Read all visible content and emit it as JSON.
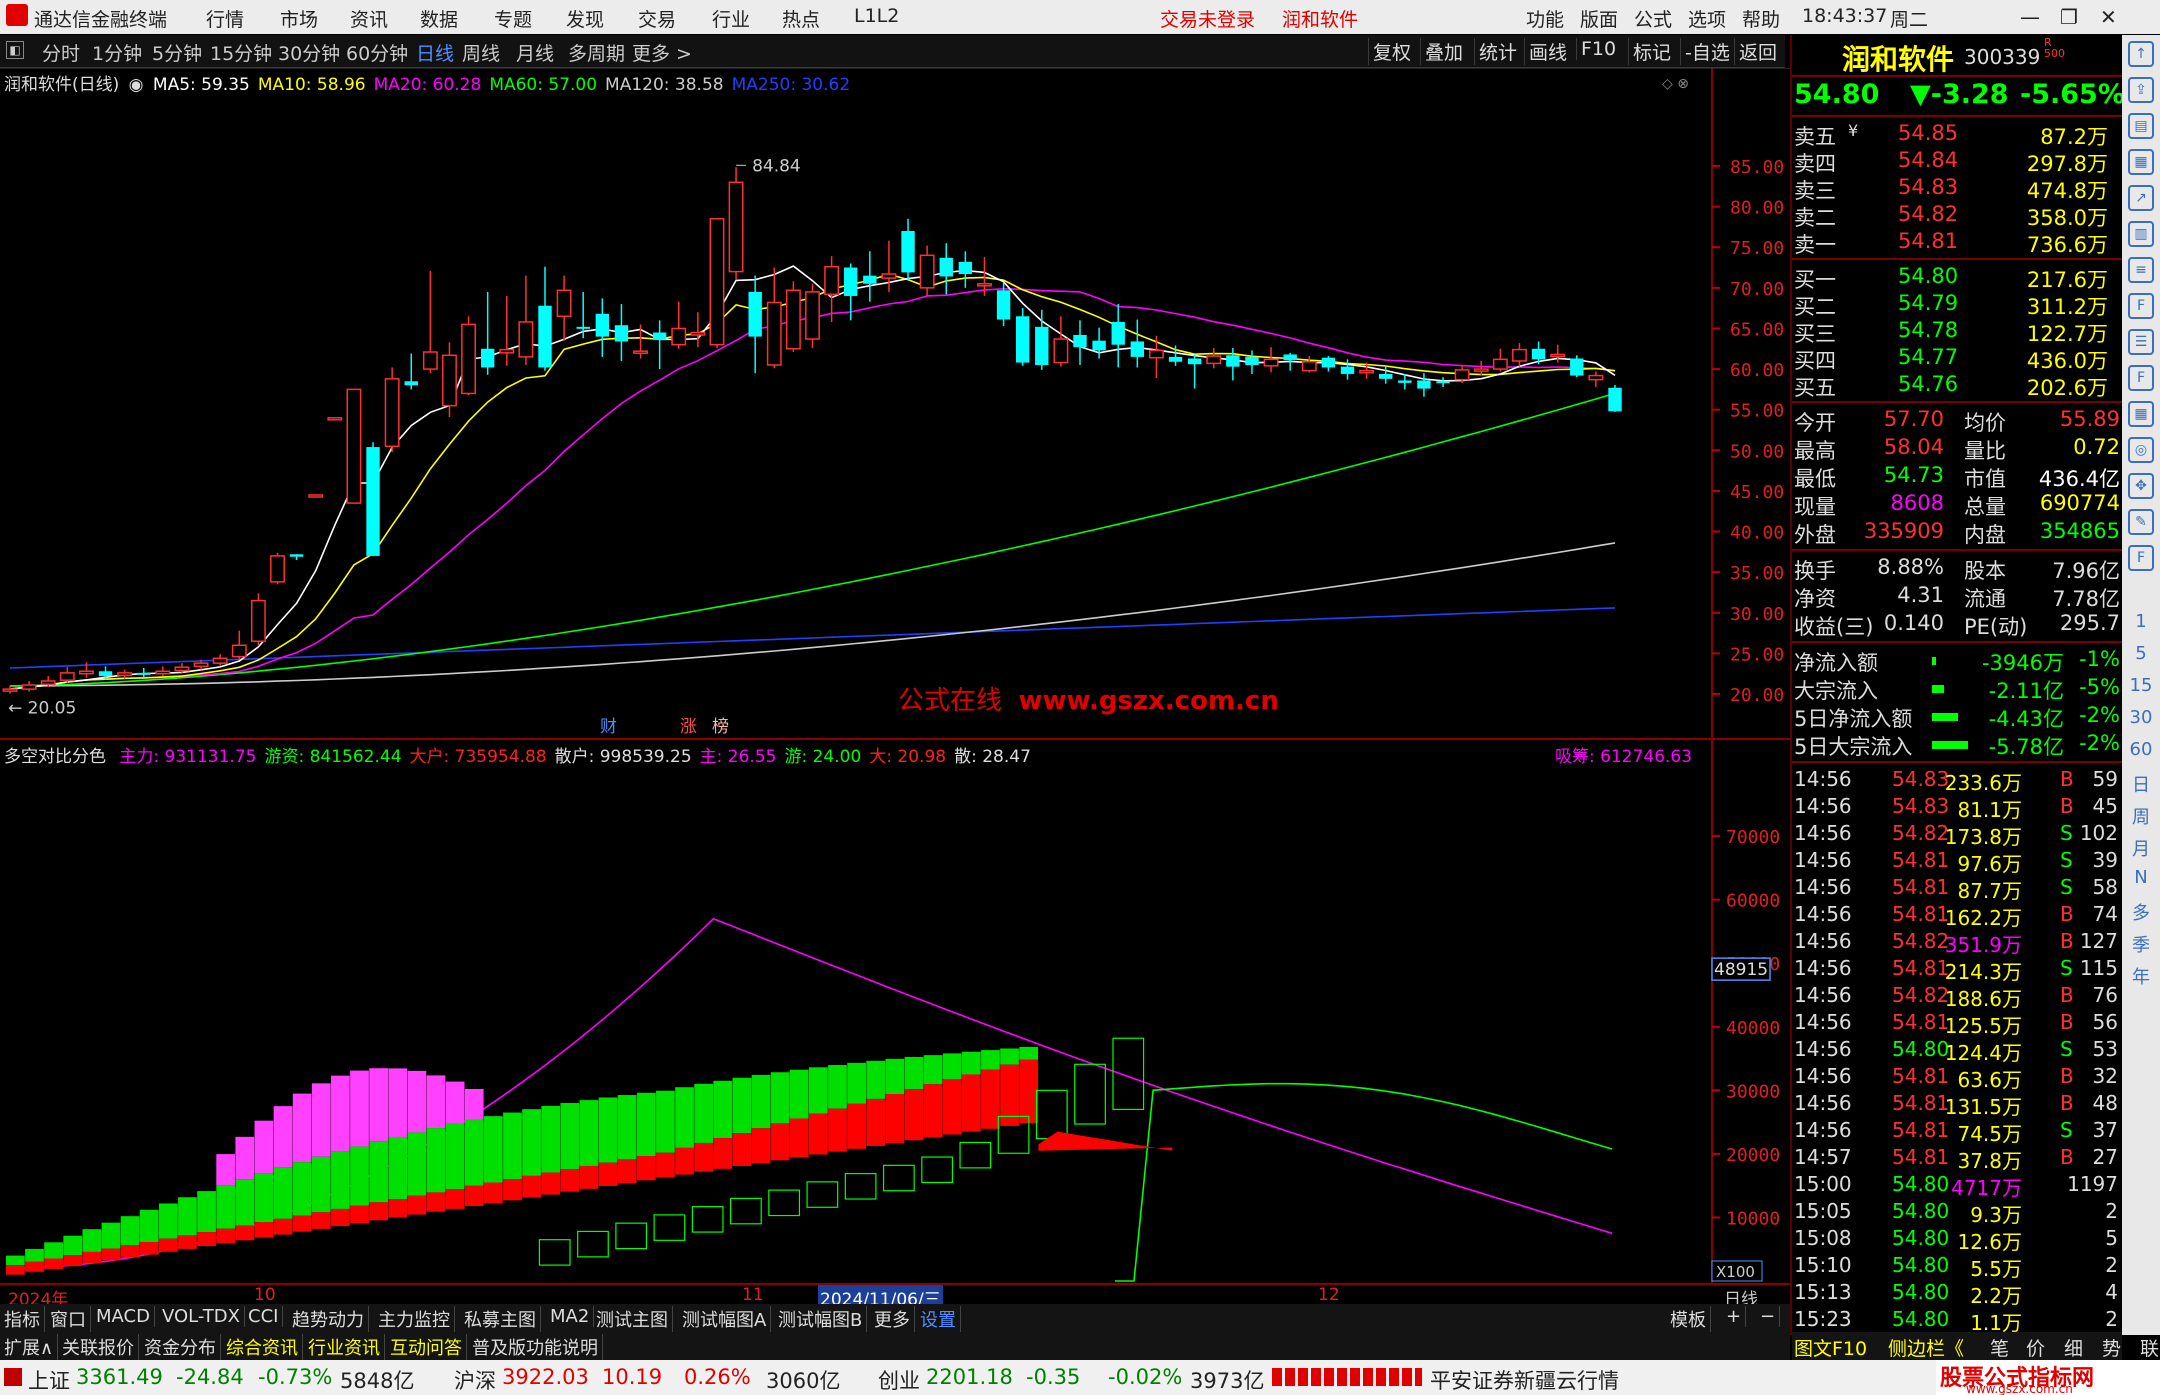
{
  "titlebar": {
    "app_title": "通达信金融终端",
    "menus": [
      "行情",
      "市场",
      "资讯",
      "数据",
      "专题",
      "发现",
      "交易",
      "行业",
      "热点",
      "L1L2"
    ],
    "trade_status": "交易未登录",
    "stock_name": "润和软件",
    "right_menus": [
      "功能",
      "版面",
      "公式",
      "选项",
      "帮助"
    ],
    "time": "18:43:37",
    "weekday": "周二"
  },
  "toolbar": {
    "periods": [
      "分时",
      "1分钟",
      "5分钟",
      "15分钟",
      "30分钟",
      "60分钟",
      "日线",
      "周线",
      "月线",
      "多周期",
      "更多 >"
    ],
    "active_period": "日线",
    "right_buttons": [
      "复权",
      "叠加",
      "统计",
      "画线",
      "F10",
      "标记",
      "-自选",
      "返回"
    ]
  },
  "main_chart": {
    "legend_prefix": "润和软件(日线)",
    "ma_labels": [
      {
        "text": "MA5: 59.35",
        "color": "#ffffff"
      },
      {
        "text": "MA10: 58.96",
        "color": "#ffff00"
      },
      {
        "text": "MA20: 60.28",
        "color": "#ff00ff"
      },
      {
        "text": "MA60: 57.00",
        "color": "#00ff00"
      },
      {
        "text": "MA120: 38.58",
        "color": "#cccccc"
      },
      {
        "text": "MA250: 30.62",
        "color": "#2040ff"
      }
    ],
    "high_label": "84.84",
    "low_label": "20.05",
    "price_ticks": [
      "85.00",
      "80.00",
      "75.00",
      "70.00",
      "65.00",
      "60.00",
      "55.00",
      "50.00",
      "45.00",
      "40.00",
      "35.00",
      "30.00",
      "25.00",
      "20.00"
    ],
    "watermark_cn": "公式在线",
    "watermark_url": "www.gszx.com.cn",
    "event_tags": [
      "财",
      "涨",
      "榜"
    ]
  },
  "sub_chart": {
    "title": "多空对比分色",
    "values": [
      {
        "text": "主力: 931131.75",
        "color": "#ff00ff"
      },
      {
        "text": "游资: 841562.44",
        "color": "#00ff00"
      },
      {
        "text": "大户: 735954.88",
        "color": "#ff2020"
      },
      {
        "text": "散户: 998539.25",
        "color": "#dddddd"
      },
      {
        "text": "主: 26.55",
        "color": "#ff00ff"
      },
      {
        "text": "游: 24.00",
        "color": "#00ff00"
      },
      {
        "text": "大: 20.98",
        "color": "#ff2020"
      },
      {
        "text": "散: 28.47",
        "color": "#dddddd"
      }
    ],
    "absorb_label": "吸筹: 612746.63",
    "y_ticks": [
      "70000",
      "60000",
      "50000",
      "40000",
      "30000",
      "20000",
      "10000"
    ],
    "current_value": "48915",
    "scale_label": "X100"
  },
  "date_axis": {
    "labels": [
      "2024年",
      "10",
      "11",
      "2024/11/06/三",
      "12"
    ],
    "period_label": "日线"
  },
  "bottom_tabs": [
    "指标",
    "窗口",
    "MACD",
    "VOL-TDX",
    "CCI",
    "趋势动力",
    "主力监控",
    "私募主图",
    "MA2",
    "测试主图",
    "测试幅图A",
    "测试幅图B",
    "更多",
    "设置"
  ],
  "bottom_right": [
    "模板",
    "+",
    "−"
  ],
  "bottom_tabs2": [
    "扩展∧",
    "关联报价",
    "资金分布",
    "综合资讯",
    "行业资讯",
    "互动问答",
    "普及版功能说明"
  ],
  "quote": {
    "name": "润和软件",
    "code": "300339",
    "price": "54.80",
    "change": "▼-3.28",
    "pct": "-5.65%",
    "asks": [
      {
        "label": "卖五",
        "p": "54.85",
        "v": "87.2万"
      },
      {
        "label": "卖四",
        "p": "54.84",
        "v": "297.8万"
      },
      {
        "label": "卖三",
        "p": "54.83",
        "v": "474.8万"
      },
      {
        "label": "卖二",
        "p": "54.82",
        "v": "358.0万"
      },
      {
        "label": "卖一",
        "p": "54.81",
        "v": "736.6万"
      }
    ],
    "bids": [
      {
        "label": "买一",
        "p": "54.80",
        "v": "217.6万"
      },
      {
        "label": "买二",
        "p": "54.79",
        "v": "311.2万"
      },
      {
        "label": "买三",
        "p": "54.78",
        "v": "122.7万"
      },
      {
        "label": "买四",
        "p": "54.77",
        "v": "436.0万"
      },
      {
        "label": "买五",
        "p": "54.76",
        "v": "202.6万"
      }
    ],
    "stats1": [
      {
        "k1": "今开",
        "v1": "57.70",
        "k2": "均价",
        "v2": "55.89",
        "c1": "#ff3030",
        "c2": "#ff3030"
      },
      {
        "k1": "最高",
        "v1": "58.04",
        "k2": "量比",
        "v2": "0.72",
        "c1": "#ff3030",
        "c2": "#ffff00"
      },
      {
        "k1": "最低",
        "v1": "54.73",
        "k2": "市值",
        "v2": "436.4亿",
        "c1": "#00ff00",
        "c2": "#ffffff"
      },
      {
        "k1": "现量",
        "v1": "8608",
        "k2": "总量",
        "v2": "690774",
        "c1": "#ff00ff",
        "c2": "#ffff00"
      },
      {
        "k1": "外盘",
        "v1": "335909",
        "k2": "内盘",
        "v2": "354865",
        "c1": "#ff3030",
        "c2": "#00ff00"
      }
    ],
    "stats2": [
      {
        "k1": "换手",
        "v1": "8.88%",
        "k2": "股本",
        "v2": "7.96亿"
      },
      {
        "k1": "净资",
        "v1": "4.31",
        "k2": "流通",
        "v2": "7.78亿"
      },
      {
        "k1": "收益(三)",
        "v1": "0.140",
        "k2": "PE(动)",
        "v2": "295.7"
      }
    ],
    "flows": [
      {
        "k": "净流入额",
        "v": "-3946万",
        "p": "-1%",
        "bar": 4
      },
      {
        "k": "大宗流入",
        "v": "-2.11亿",
        "p": "-5%",
        "bar": 12
      },
      {
        "k": "5日净流入额",
        "v": "-4.43亿",
        "p": "-2%",
        "bar": 26
      },
      {
        "k": "5日大宗流入",
        "v": "-5.78亿",
        "p": "-2%",
        "bar": 36
      }
    ],
    "ticks": [
      {
        "t": "14:56",
        "p": "54.83",
        "v": "233.6万",
        "s": "B",
        "n": "59",
        "pc": "#ff3030",
        "vc": "#ffff00"
      },
      {
        "t": "14:56",
        "p": "54.83",
        "v": "81.1万",
        "s": "B",
        "n": "45",
        "pc": "#ff3030",
        "vc": "#ffff00"
      },
      {
        "t": "14:56",
        "p": "54.82",
        "v": "173.8万",
        "s": "S",
        "n": "102",
        "pc": "#ff3030",
        "vc": "#ffff00"
      },
      {
        "t": "14:56",
        "p": "54.81",
        "v": "97.6万",
        "s": "S",
        "n": "39",
        "pc": "#ff3030",
        "vc": "#ffff00"
      },
      {
        "t": "14:56",
        "p": "54.81",
        "v": "87.7万",
        "s": "S",
        "n": "58",
        "pc": "#ff3030",
        "vc": "#ffff00"
      },
      {
        "t": "14:56",
        "p": "54.81",
        "v": "162.2万",
        "s": "B",
        "n": "74",
        "pc": "#ff3030",
        "vc": "#ffff00"
      },
      {
        "t": "14:56",
        "p": "54.82",
        "v": "351.9万",
        "s": "B",
        "n": "127",
        "pc": "#ff3030",
        "vc": "#ff00ff"
      },
      {
        "t": "14:56",
        "p": "54.81",
        "v": "214.3万",
        "s": "S",
        "n": "115",
        "pc": "#ff3030",
        "vc": "#ffff00"
      },
      {
        "t": "14:56",
        "p": "54.82",
        "v": "188.6万",
        "s": "B",
        "n": "76",
        "pc": "#ff3030",
        "vc": "#ffff00"
      },
      {
        "t": "14:56",
        "p": "54.81",
        "v": "125.5万",
        "s": "B",
        "n": "56",
        "pc": "#ff3030",
        "vc": "#ffff00"
      },
      {
        "t": "14:56",
        "p": "54.80",
        "v": "124.4万",
        "s": "S",
        "n": "53",
        "pc": "#00ff00",
        "vc": "#ffff00"
      },
      {
        "t": "14:56",
        "p": "54.81",
        "v": "63.6万",
        "s": "B",
        "n": "32",
        "pc": "#ff3030",
        "vc": "#ffff00"
      },
      {
        "t": "14:56",
        "p": "54.81",
        "v": "131.5万",
        "s": "B",
        "n": "48",
        "pc": "#ff3030",
        "vc": "#ffff00"
      },
      {
        "t": "14:56",
        "p": "54.81",
        "v": "74.5万",
        "s": "S",
        "n": "37",
        "pc": "#ff3030",
        "vc": "#ffff00"
      },
      {
        "t": "14:57",
        "p": "54.81",
        "v": "37.8万",
        "s": "B",
        "n": "27",
        "pc": "#ff3030",
        "vc": "#ffff00"
      },
      {
        "t": "15:00",
        "p": "54.80",
        "v": "4717万",
        "s": "",
        "n": "1197",
        "pc": "#00ff00",
        "vc": "#ff00ff"
      },
      {
        "t": "15:05",
        "p": "54.80",
        "v": "9.3万",
        "s": "",
        "n": "2",
        "pc": "#00ff00",
        "vc": "#ffff00"
      },
      {
        "t": "15:08",
        "p": "54.80",
        "v": "12.6万",
        "s": "",
        "n": "5",
        "pc": "#00ff00",
        "vc": "#ffff00"
      },
      {
        "t": "15:10",
        "p": "54.80",
        "v": "5.5万",
        "s": "",
        "n": "2",
        "pc": "#00ff00",
        "vc": "#ffff00"
      },
      {
        "t": "15:13",
        "p": "54.80",
        "v": "2.2万",
        "s": "",
        "n": "4",
        "pc": "#00ff00",
        "vc": "#ffff00"
      },
      {
        "t": "15:23",
        "p": "54.80",
        "v": "1.1万",
        "s": "",
        "n": "2",
        "pc": "#00ff00",
        "vc": "#ffff00"
      }
    ],
    "bottom_tabs": [
      "图文F10",
      "侧边栏《",
      "笔",
      "价",
      "细",
      "势",
      "联"
    ]
  },
  "side_strip": {
    "texts": [
      "1",
      "5",
      "15",
      "30",
      "60",
      "日",
      "周",
      "月",
      "N",
      "多",
      "季",
      "年"
    ]
  },
  "status": {
    "indices": [
      {
        "name": "上证",
        "val": "3361.49",
        "chg": "-24.84",
        "pct": "-0.73%",
        "amt": "5848亿"
      },
      {
        "name": "沪深",
        "val": "3922.03",
        "chg": "10.19",
        "pct": "0.26%",
        "amt": "3060亿"
      },
      {
        "name": "创业",
        "val": "2201.18",
        "chg": "-0.35",
        "pct": "-0.02%",
        "amt": "3973亿"
      }
    ],
    "broker": "平安证券新疆云行情",
    "brand": "股票公式指标网",
    "brand_url": "www.gszx.com.cn"
  },
  "colors": {
    "up": "#ff3030",
    "down": "#00ffff",
    "ma5": "#ffffff",
    "ma10": "#ffff00",
    "ma20": "#ff00ff",
    "ma60": "#00ff00",
    "ma120": "#cccccc",
    "ma250": "#2040ff"
  }
}
